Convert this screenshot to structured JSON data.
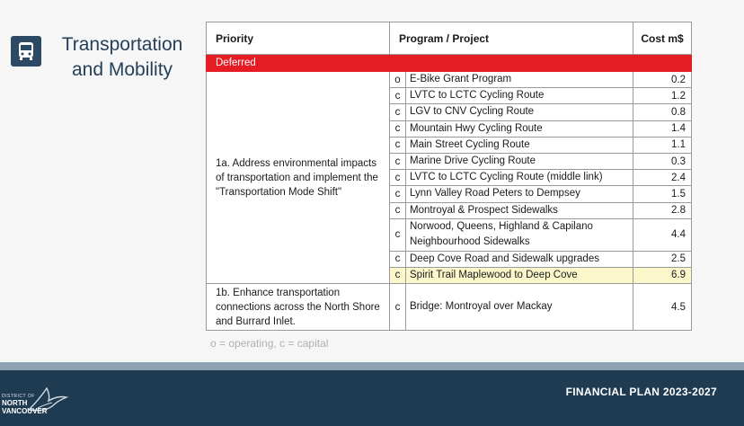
{
  "section": {
    "title": "Transportation and Mobility",
    "icon": "bus-icon"
  },
  "table": {
    "headers": {
      "priority": "Priority",
      "program": "Program / Project",
      "cost": "Cost m$"
    },
    "group_label": "Deferred",
    "priority_1a": "1a. Address environmental impacts of transportation and implement the \"Transportation Mode Shift\"",
    "priority_1b": "1b. Enhance transportation connections across the North Shore and Burrard Inlet.",
    "rows": [
      {
        "code": "o",
        "program": "E-Bike Grant Program",
        "cost": "0.2"
      },
      {
        "code": "c",
        "program": "LVTC to LCTC Cycling Route",
        "cost": "1.2"
      },
      {
        "code": "c",
        "program": "LGV to CNV Cycling Route",
        "cost": "0.8"
      },
      {
        "code": "c",
        "program": "Mountain Hwy Cycling Route",
        "cost": "1.4"
      },
      {
        "code": "c",
        "program": "Main Street Cycling Route",
        "cost": "1.1"
      },
      {
        "code": "c",
        "program": "Marine Drive Cycling Route",
        "cost": "0.3"
      },
      {
        "code": "c",
        "program": "LVTC to LCTC Cycling Route (middle link)",
        "cost": "2.4"
      },
      {
        "code": "c",
        "program": "Lynn Valley Road Peters to Dempsey",
        "cost": "1.5"
      },
      {
        "code": "c",
        "program": "Montroyal & Prospect Sidewalks",
        "cost": "2.8"
      },
      {
        "code": "c",
        "program": "Norwood, Queens, Highland & Capilano Neighbourhood Sidewalks",
        "cost": "4.4"
      },
      {
        "code": "c",
        "program": "Deep Cove Road and Sidewalk upgrades",
        "cost": "2.5"
      },
      {
        "code": "c",
        "program": "Spirit Trail Maplewood to Deep Cove",
        "cost": "6.9"
      },
      {
        "code": "c",
        "program": "Bridge: Montroyal over Mackay",
        "cost": "4.5"
      }
    ],
    "colors": {
      "deferred_bar": "#e51c23",
      "header_text": "#243f58"
    }
  },
  "legend": "o = operating, c = capital",
  "footer": {
    "plan_title": "FINANCIAL PLAN 2023-2027",
    "logo_line1": "DISTRICT OF",
    "logo_line2": "NORTH",
    "logo_line3": "VANCOUVER",
    "logo_icon": "eagle-logo-icon"
  }
}
